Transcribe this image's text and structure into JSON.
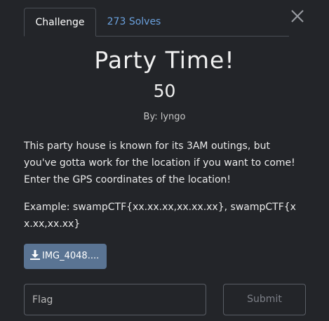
{
  "tabs": {
    "challenge": "Challenge",
    "solves": "273 Solves"
  },
  "challenge": {
    "title": "Party Time!",
    "points": "50",
    "author": "By: lyngo",
    "description": "This party house is known for its 3AM outings, but you've gotta work for the location if you want to come! Enter the GPS coordinates of the location!",
    "example": "Example: swampCTF{xx.xx.xx,xx.xx.xx}, swampCTF{xx.xx,xx.xx}"
  },
  "attachment": {
    "label": "IMG_4048...."
  },
  "form": {
    "flag_placeholder": "Flag",
    "submit_label": "Submit"
  },
  "icons": {
    "close": "close-icon",
    "download": "download-icon"
  },
  "colors": {
    "background": "#232529",
    "link": "#6aa0dc",
    "file_button": "#5a7493"
  }
}
